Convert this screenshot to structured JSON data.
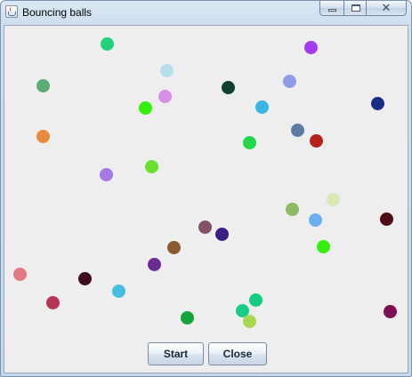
{
  "window": {
    "title": "Bouncing balls"
  },
  "buttons": {
    "start_label": "Start",
    "close_label": "Close"
  },
  "title_icon": "java-coffee-cup-icon",
  "caption_icons": [
    "minimize-icon",
    "maximize-icon",
    "close-icon"
  ],
  "panel_background": "#eeeeee",
  "balls": [
    {
      "color": "#21d17c"
    },
    {
      "color": "#a23bee"
    },
    {
      "color": "#b6dfee"
    },
    {
      "color": "#5bac74"
    },
    {
      "color": "#d98ee6"
    },
    {
      "color": "#0f4030"
    },
    {
      "color": "#8f9be6"
    },
    {
      "color": "#35f00f"
    },
    {
      "color": "#3bb5e6"
    },
    {
      "color": "#1a2d86"
    },
    {
      "color": "#e88c3c"
    },
    {
      "color": "#5c7ba2"
    },
    {
      "color": "#b5221e"
    },
    {
      "color": "#21d848"
    },
    {
      "color": "#a57ae6"
    },
    {
      "color": "#67e030"
    },
    {
      "color": "#dae8b6"
    },
    {
      "color": "#8fba64"
    },
    {
      "color": "#6ab0ef"
    },
    {
      "color": "#4d0d16"
    },
    {
      "color": "#845266"
    },
    {
      "color": "#3a1f87"
    },
    {
      "color": "#35f00f"
    },
    {
      "color": "#8a5b30"
    },
    {
      "color": "#e37983"
    },
    {
      "color": "#6b2d94"
    },
    {
      "color": "#3e0d1c"
    },
    {
      "color": "#45bfe0"
    },
    {
      "color": "#b83456"
    },
    {
      "color": "#14cd84"
    },
    {
      "color": "#18cb88"
    },
    {
      "color": "#7f0d54"
    },
    {
      "color": "#13a538"
    },
    {
      "color": "#a8d84e"
    }
  ]
}
